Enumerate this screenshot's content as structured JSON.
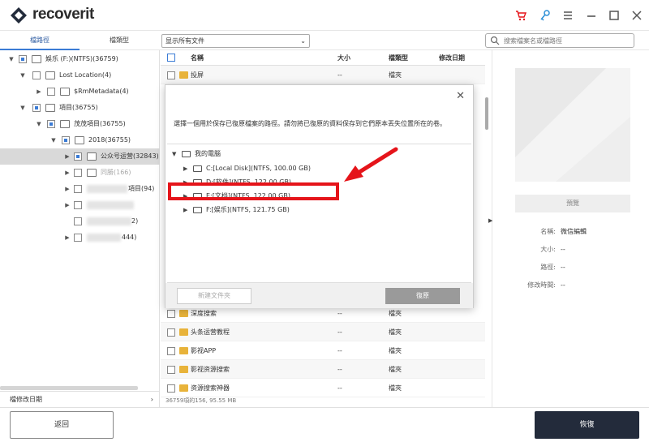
{
  "app": {
    "name": "recoverit"
  },
  "left_tabs": [
    {
      "label": "檔路徑"
    },
    {
      "label": "檔類型"
    }
  ],
  "filter": {
    "value": "显示所有文件"
  },
  "search": {
    "placeholder": "搜索檔案名或檔路徑"
  },
  "tree": [
    {
      "label": "娛乐 (F:)(NTFS)(36759)"
    },
    {
      "label": "Lost Location(4)"
    },
    {
      "label": "$RmMetadata(4)"
    },
    {
      "label": "項目(36755)"
    },
    {
      "label": "茂茂項目(36755)"
    },
    {
      "label": "2018(36755)"
    },
    {
      "label": "公众号运营(32843)"
    },
    {
      "label": "同勝(166)"
    },
    {
      "label": "項目(94)"
    },
    {
      "label": ""
    },
    {
      "label": "2)"
    },
    {
      "label": "444)"
    }
  ],
  "left_bottom": {
    "label": "檔修改日期"
  },
  "columns": {
    "name": "名稱",
    "size": "大小",
    "type": "檔類型",
    "date": "修改日期"
  },
  "files_top": [
    {
      "name": "投屏",
      "size": "--",
      "type": "檔夾",
      "date": ""
    }
  ],
  "files_bottom": [
    {
      "name": "深度搜索",
      "size": "--",
      "type": "檔夾",
      "date": ""
    },
    {
      "name": "头条运营教程",
      "size": "--",
      "type": "檔夾",
      "date": ""
    },
    {
      "name": "影视APP",
      "size": "--",
      "type": "檔夾",
      "date": ""
    },
    {
      "name": "影视资源搜索",
      "size": "--",
      "type": "檔夾",
      "date": ""
    },
    {
      "name": "资源搜索神器",
      "size": "--",
      "type": "檔夾",
      "date": ""
    }
  ],
  "status": {
    "text": "36759項的156, 95.55 MB"
  },
  "preview": {
    "button": "預覽"
  },
  "meta": [
    {
      "key": "名稱:",
      "value": "微信編輯"
    },
    {
      "key": "大小:",
      "value": "--"
    },
    {
      "key": "路徑:",
      "value": "--"
    },
    {
      "key": "修改時間:",
      "value": "--"
    }
  ],
  "dialog": {
    "message": "選擇一個用於保存已復原檔案的路徑。請勿將已復原的資料保存到它們原本丟失位置所在的卷。",
    "root": "我的電腦",
    "drives": [
      {
        "label": "C:[Local Disk](NTFS, 100.00  GB)"
      },
      {
        "label": "D:[软件](NTFS, 122.00  GB)"
      },
      {
        "label": "E:[文档](NTFS, 122.00  GB)"
      },
      {
        "label": "F:[娱乐](NTFS, 121.75  GB)"
      }
    ],
    "new_folder": "新建文件夾",
    "restore": "復原"
  },
  "bottom": {
    "back": "返回",
    "recover": "恢復"
  },
  "colors": {
    "accent": "#3a7bd5",
    "dark": "#232b3b",
    "highlight": "#e5141a",
    "folder": "#e8b33a"
  }
}
